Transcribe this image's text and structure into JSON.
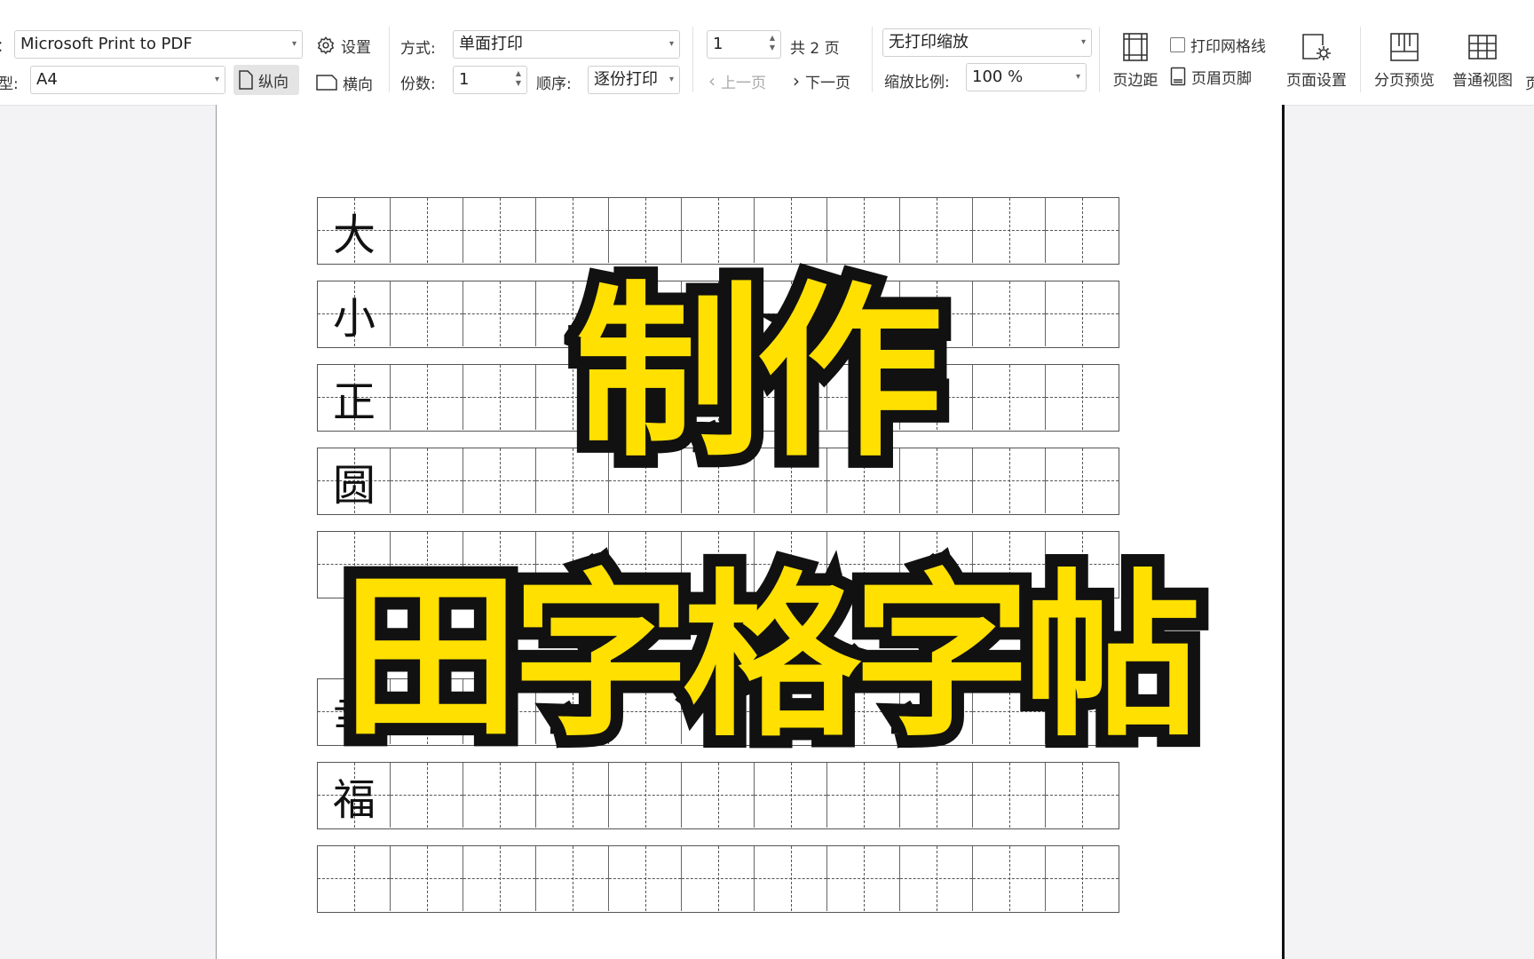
{
  "toolbar": {
    "printer": {
      "label_fragment": "：",
      "value": "Microsoft Print to PDF"
    },
    "settings_label": "设置",
    "paper": {
      "label_fragment": "型:",
      "value": "A4"
    },
    "portrait_label": "纵向",
    "landscape_label": "横向",
    "mode": {
      "label": "方式:",
      "value": "单面打印"
    },
    "copies": {
      "label": "份数:",
      "value": "1"
    },
    "order": {
      "label": "顺序:",
      "value": "逐份打印"
    },
    "page_input": "1",
    "total_pages": "共 2 页",
    "prev_page": "上一页",
    "next_page": "下一页",
    "scaling": {
      "value": "无打印缩放",
      "ratio_label": "缩放比例:",
      "ratio_value": "100 %"
    },
    "margins_label": "页边距",
    "print_gridlines_label": "打印网格线",
    "header_footer_label": "页眉页脚",
    "page_setup_label": "页面设置",
    "page_break_preview_label": "分页预览",
    "normal_view_label": "普通视图",
    "cut_label": "页"
  },
  "sheet": {
    "rows": [
      {
        "char": "大"
      },
      {
        "char": "小"
      },
      {
        "char": "正"
      },
      {
        "char": "圆"
      },
      {
        "char": ""
      },
      {
        "char": "幸"
      },
      {
        "char": "福"
      },
      {
        "char": ""
      }
    ]
  },
  "overlay": {
    "line1": "制作",
    "line2": "田字格字帖"
  },
  "colors": {
    "title_fill": "#ffe000",
    "title_outline": "#111111"
  }
}
